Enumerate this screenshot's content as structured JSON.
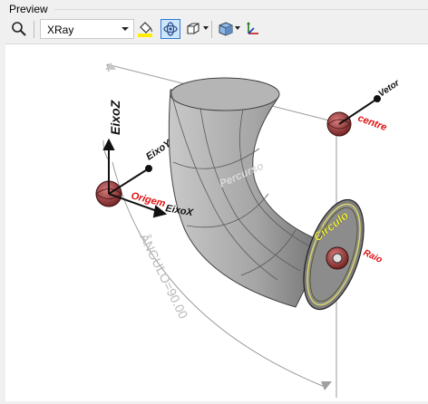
{
  "group": {
    "title": "Preview"
  },
  "toolbar": {
    "render_mode": "XRay"
  },
  "scene": {
    "labels": {
      "axis_z": "EixoZ",
      "axis_y": "EixoY",
      "axis_x": "EixoX",
      "origin": "Origem",
      "vec": "Vetor",
      "centre": "centre",
      "path": "Percurso",
      "circle": "Circulo",
      "radius": "Raio",
      "angle": "ÂNGULO=90.00"
    }
  },
  "colors": {
    "accent_active": "#2b7ad6",
    "label_red": "#e01010",
    "label_yellow": "#ffff33",
    "pipe_gray": "#9a9a9a",
    "node_red": "#a33a3a"
  }
}
